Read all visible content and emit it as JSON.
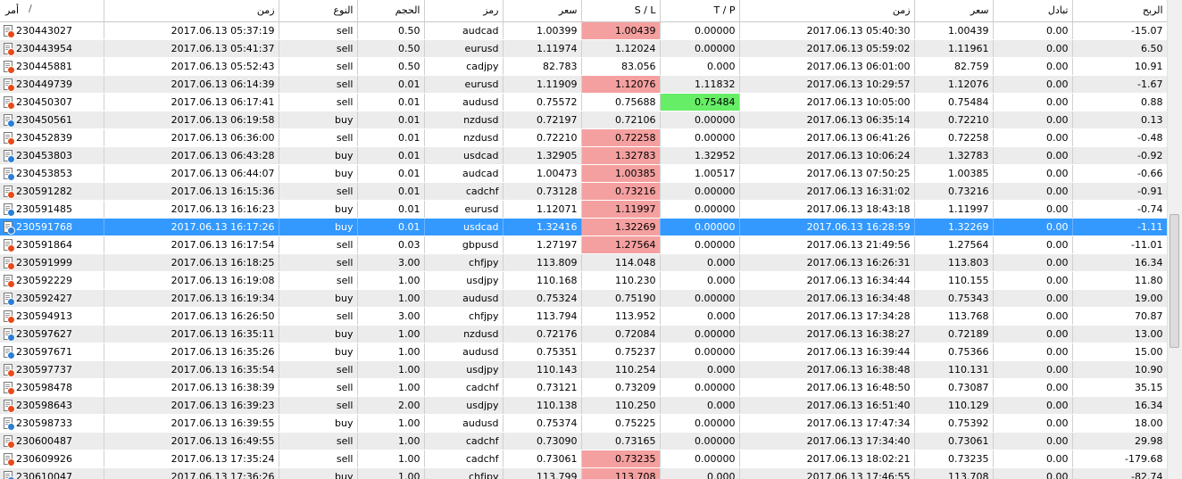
{
  "columns": {
    "order": "أمر",
    "order_sort": "/",
    "open_time": "زمن",
    "type": "النوع",
    "volume": "الحجم",
    "symbol": "رمز",
    "open_price": "سعر",
    "sl": "S / L",
    "tp": "T / P",
    "close_time": "زمن",
    "close_price": "سعر",
    "swap": "تبادل",
    "profit": "الربح"
  },
  "colors": {
    "selected_row": "#3399ff",
    "sl_hit": "#f5a0a0",
    "tp_hit": "#66ee66",
    "sell_icon": "#e84a1a",
    "buy_icon": "#2a7fd4"
  },
  "scroll": {
    "position_fraction": 0.62
  },
  "rows": [
    {
      "order": "230443027",
      "open_time": "2017.06.13 05:37:19",
      "type": "sell",
      "volume": "0.50",
      "symbol": "audcad",
      "open_price": "1.00399",
      "sl": "1.00439",
      "tp": "0.00000",
      "close_time": "2017.06.13 05:40:30",
      "close_price": "1.00439",
      "swap": "0.00",
      "profit": "-15.07",
      "hit": "sl"
    },
    {
      "order": "230443954",
      "open_time": "2017.06.13 05:41:37",
      "type": "sell",
      "volume": "0.50",
      "symbol": "eurusd",
      "open_price": "1.11974",
      "sl": "1.12024",
      "tp": "0.00000",
      "close_time": "2017.06.13 05:59:02",
      "close_price": "1.11961",
      "swap": "0.00",
      "profit": "6.50",
      "hit": ""
    },
    {
      "order": "230445881",
      "open_time": "2017.06.13 05:52:43",
      "type": "sell",
      "volume": "0.50",
      "symbol": "cadjpy",
      "open_price": "82.783",
      "sl": "83.056",
      "tp": "0.000",
      "close_time": "2017.06.13 06:01:00",
      "close_price": "82.759",
      "swap": "0.00",
      "profit": "10.91",
      "hit": ""
    },
    {
      "order": "230449739",
      "open_time": "2017.06.13 06:14:39",
      "type": "sell",
      "volume": "0.01",
      "symbol": "eurusd",
      "open_price": "1.11909",
      "sl": "1.12076",
      "tp": "1.11832",
      "close_time": "2017.06.13 10:29:57",
      "close_price": "1.12076",
      "swap": "0.00",
      "profit": "-1.67",
      "hit": "sl"
    },
    {
      "order": "230450307",
      "open_time": "2017.06.13 06:17:41",
      "type": "sell",
      "volume": "0.01",
      "symbol": "audusd",
      "open_price": "0.75572",
      "sl": "0.75688",
      "tp": "0.75484",
      "close_time": "2017.06.13 10:05:00",
      "close_price": "0.75484",
      "swap": "0.00",
      "profit": "0.88",
      "hit": "tp"
    },
    {
      "order": "230450561",
      "open_time": "2017.06.13 06:19:58",
      "type": "buy",
      "volume": "0.01",
      "symbol": "nzdusd",
      "open_price": "0.72197",
      "sl": "0.72106",
      "tp": "0.00000",
      "close_time": "2017.06.13 06:35:14",
      "close_price": "0.72210",
      "swap": "0.00",
      "profit": "0.13",
      "hit": ""
    },
    {
      "order": "230452839",
      "open_time": "2017.06.13 06:36:00",
      "type": "sell",
      "volume": "0.01",
      "symbol": "nzdusd",
      "open_price": "0.72210",
      "sl": "0.72258",
      "tp": "0.00000",
      "close_time": "2017.06.13 06:41:26",
      "close_price": "0.72258",
      "swap": "0.00",
      "profit": "-0.48",
      "hit": "sl"
    },
    {
      "order": "230453803",
      "open_time": "2017.06.13 06:43:28",
      "type": "buy",
      "volume": "0.01",
      "symbol": "usdcad",
      "open_price": "1.32905",
      "sl": "1.32783",
      "tp": "1.32952",
      "close_time": "2017.06.13 10:06:24",
      "close_price": "1.32783",
      "swap": "0.00",
      "profit": "-0.92",
      "hit": "sl"
    },
    {
      "order": "230453853",
      "open_time": "2017.06.13 06:44:07",
      "type": "buy",
      "volume": "0.01",
      "symbol": "audcad",
      "open_price": "1.00473",
      "sl": "1.00385",
      "tp": "1.00517",
      "close_time": "2017.06.13 07:50:25",
      "close_price": "1.00385",
      "swap": "0.00",
      "profit": "-0.66",
      "hit": "sl"
    },
    {
      "order": "230591282",
      "open_time": "2017.06.13 16:15:36",
      "type": "sell",
      "volume": "0.01",
      "symbol": "cadchf",
      "open_price": "0.73128",
      "sl": "0.73216",
      "tp": "0.00000",
      "close_time": "2017.06.13 16:31:02",
      "close_price": "0.73216",
      "swap": "0.00",
      "profit": "-0.91",
      "hit": "sl"
    },
    {
      "order": "230591485",
      "open_time": "2017.06.13 16:16:23",
      "type": "buy",
      "volume": "0.01",
      "symbol": "eurusd",
      "open_price": "1.12071",
      "sl": "1.11997",
      "tp": "0.00000",
      "close_time": "2017.06.13 18:43:18",
      "close_price": "1.11997",
      "swap": "0.00",
      "profit": "-0.74",
      "hit": "sl"
    },
    {
      "order": "230591768",
      "open_time": "2017.06.13 16:17:26",
      "type": "buy",
      "volume": "0.01",
      "symbol": "usdcad",
      "open_price": "1.32416",
      "sl": "1.32269",
      "tp": "0.00000",
      "close_time": "2017.06.13 16:28:59",
      "close_price": "1.32269",
      "swap": "0.00",
      "profit": "-1.11",
      "hit": "sl",
      "selected": true
    },
    {
      "order": "230591864",
      "open_time": "2017.06.13 16:17:54",
      "type": "sell",
      "volume": "0.03",
      "symbol": "gbpusd",
      "open_price": "1.27197",
      "sl": "1.27564",
      "tp": "0.00000",
      "close_time": "2017.06.13 21:49:56",
      "close_price": "1.27564",
      "swap": "0.00",
      "profit": "-11.01",
      "hit": "sl"
    },
    {
      "order": "230591999",
      "open_time": "2017.06.13 16:18:25",
      "type": "sell",
      "volume": "3.00",
      "symbol": "chfjpy",
      "open_price": "113.809",
      "sl": "114.048",
      "tp": "0.000",
      "close_time": "2017.06.13 16:26:31",
      "close_price": "113.803",
      "swap": "0.00",
      "profit": "16.34",
      "hit": ""
    },
    {
      "order": "230592229",
      "open_time": "2017.06.13 16:19:08",
      "type": "sell",
      "volume": "1.00",
      "symbol": "usdjpy",
      "open_price": "110.168",
      "sl": "110.230",
      "tp": "0.000",
      "close_time": "2017.06.13 16:34:44",
      "close_price": "110.155",
      "swap": "0.00",
      "profit": "11.80",
      "hit": ""
    },
    {
      "order": "230592427",
      "open_time": "2017.06.13 16:19:34",
      "type": "buy",
      "volume": "1.00",
      "symbol": "audusd",
      "open_price": "0.75324",
      "sl": "0.75190",
      "tp": "0.00000",
      "close_time": "2017.06.13 16:34:48",
      "close_price": "0.75343",
      "swap": "0.00",
      "profit": "19.00",
      "hit": ""
    },
    {
      "order": "230594913",
      "open_time": "2017.06.13 16:26:50",
      "type": "sell",
      "volume": "3.00",
      "symbol": "chfjpy",
      "open_price": "113.794",
      "sl": "113.952",
      "tp": "0.000",
      "close_time": "2017.06.13 17:34:28",
      "close_price": "113.768",
      "swap": "0.00",
      "profit": "70.87",
      "hit": ""
    },
    {
      "order": "230597627",
      "open_time": "2017.06.13 16:35:11",
      "type": "buy",
      "volume": "1.00",
      "symbol": "nzdusd",
      "open_price": "0.72176",
      "sl": "0.72084",
      "tp": "0.00000",
      "close_time": "2017.06.13 16:38:27",
      "close_price": "0.72189",
      "swap": "0.00",
      "profit": "13.00",
      "hit": ""
    },
    {
      "order": "230597671",
      "open_time": "2017.06.13 16:35:26",
      "type": "buy",
      "volume": "1.00",
      "symbol": "audusd",
      "open_price": "0.75351",
      "sl": "0.75237",
      "tp": "0.00000",
      "close_time": "2017.06.13 16:39:44",
      "close_price": "0.75366",
      "swap": "0.00",
      "profit": "15.00",
      "hit": ""
    },
    {
      "order": "230597737",
      "open_time": "2017.06.13 16:35:54",
      "type": "sell",
      "volume": "1.00",
      "symbol": "usdjpy",
      "open_price": "110.143",
      "sl": "110.254",
      "tp": "0.000",
      "close_time": "2017.06.13 16:38:48",
      "close_price": "110.131",
      "swap": "0.00",
      "profit": "10.90",
      "hit": ""
    },
    {
      "order": "230598478",
      "open_time": "2017.06.13 16:38:39",
      "type": "sell",
      "volume": "1.00",
      "symbol": "cadchf",
      "open_price": "0.73121",
      "sl": "0.73209",
      "tp": "0.00000",
      "close_time": "2017.06.13 16:48:50",
      "close_price": "0.73087",
      "swap": "0.00",
      "profit": "35.15",
      "hit": ""
    },
    {
      "order": "230598643",
      "open_time": "2017.06.13 16:39:23",
      "type": "sell",
      "volume": "2.00",
      "symbol": "usdjpy",
      "open_price": "110.138",
      "sl": "110.250",
      "tp": "0.000",
      "close_time": "2017.06.13 16:51:40",
      "close_price": "110.129",
      "swap": "0.00",
      "profit": "16.34",
      "hit": ""
    },
    {
      "order": "230598733",
      "open_time": "2017.06.13 16:39:55",
      "type": "buy",
      "volume": "1.00",
      "symbol": "audusd",
      "open_price": "0.75374",
      "sl": "0.75225",
      "tp": "0.00000",
      "close_time": "2017.06.13 17:47:34",
      "close_price": "0.75392",
      "swap": "0.00",
      "profit": "18.00",
      "hit": ""
    },
    {
      "order": "230600487",
      "open_time": "2017.06.13 16:49:55",
      "type": "sell",
      "volume": "1.00",
      "symbol": "cadchf",
      "open_price": "0.73090",
      "sl": "0.73165",
      "tp": "0.00000",
      "close_time": "2017.06.13 17:34:40",
      "close_price": "0.73061",
      "swap": "0.00",
      "profit": "29.98",
      "hit": ""
    },
    {
      "order": "230609926",
      "open_time": "2017.06.13 17:35:24",
      "type": "sell",
      "volume": "1.00",
      "symbol": "cadchf",
      "open_price": "0.73061",
      "sl": "0.73235",
      "tp": "0.00000",
      "close_time": "2017.06.13 18:02:21",
      "close_price": "0.73235",
      "swap": "0.00",
      "profit": "-179.68",
      "hit": "sl"
    },
    {
      "order": "230610047",
      "open_time": "2017.06.13 17:36:26",
      "type": "buy",
      "volume": "1.00",
      "symbol": "chfjpy",
      "open_price": "113.799",
      "sl": "113.708",
      "tp": "0.000",
      "close_time": "2017.06.13 17:46:55",
      "close_price": "113.708",
      "swap": "0.00",
      "profit": "-82.74",
      "hit": "sl"
    }
  ]
}
